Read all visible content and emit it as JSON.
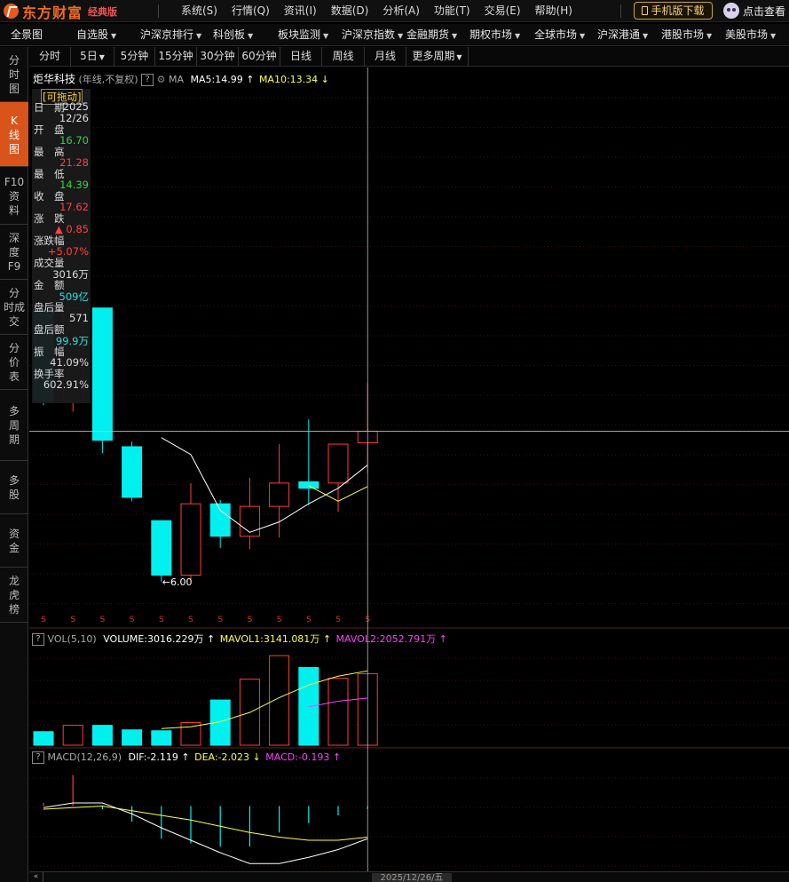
{
  "app": {
    "logo_text": "东方财富",
    "edition": "经典版"
  },
  "menu": [
    "系统(S)",
    "行情(Q)",
    "资讯(I)",
    "数据(D)",
    "分析(A)",
    "功能(T)",
    "交易(E)",
    "帮助(H)"
  ],
  "mobile_download": "手机版下载",
  "view_button": "点击查看",
  "nav": [
    {
      "label": "全景图",
      "dropdown": false
    },
    {
      "label": "自选股",
      "dropdown": true
    },
    {
      "label": "沪深京排行",
      "dropdown": true
    },
    {
      "label": "科创板",
      "dropdown": true
    },
    {
      "label": "板块监测",
      "dropdown": true
    },
    {
      "label": "沪深京指数",
      "dropdown": true
    },
    {
      "label": "金融期货",
      "dropdown": true
    },
    {
      "label": "期权市场",
      "dropdown": true
    },
    {
      "label": "全球市场",
      "dropdown": true
    },
    {
      "label": "沪深港通",
      "dropdown": true
    },
    {
      "label": "港股市场",
      "dropdown": true
    },
    {
      "label": "美股市场",
      "dropdown": true
    }
  ],
  "left_tabs": [
    {
      "label": [
        "分",
        "时",
        "图"
      ],
      "active": false
    },
    {
      "label": [
        "K",
        "线",
        "图"
      ],
      "active": true
    },
    {
      "label": [
        "F10",
        "资",
        "料"
      ],
      "active": false
    },
    {
      "label": [
        "深",
        "度",
        "F9"
      ],
      "active": false
    },
    {
      "label": [
        "分",
        "时成",
        "交"
      ],
      "active": false
    },
    {
      "label": [
        "分",
        "价",
        "表"
      ],
      "active": false
    },
    {
      "label": [
        "多",
        "周",
        "期"
      ],
      "active": false
    },
    {
      "label": [
        "多",
        "股"
      ],
      "active": false
    },
    {
      "label": [
        "资",
        "金"
      ],
      "active": false
    },
    {
      "label": [
        "龙",
        "虎",
        "榜"
      ],
      "active": false
    }
  ],
  "periods": [
    {
      "label": "分时",
      "dropdown": false
    },
    {
      "label": "5日",
      "dropdown": true
    },
    {
      "label": "5分钟",
      "dropdown": false
    },
    {
      "label": "15分钟",
      "dropdown": false
    },
    {
      "label": "30分钟",
      "dropdown": false
    },
    {
      "label": "60分钟",
      "dropdown": false
    },
    {
      "label": "日线",
      "dropdown": false
    },
    {
      "label": "周线",
      "dropdown": false
    },
    {
      "label": "月线",
      "dropdown": false
    },
    {
      "label": "更多周期",
      "dropdown": true
    }
  ],
  "kline_header": {
    "stock_name": "炬华科技",
    "cycle": "(年线,不复权)",
    "q": "?",
    "ma_label": "MA",
    "ma5": "MA5:14.99",
    "ma10": "MA10:13.34",
    "ma5_arrow": "↑",
    "ma10_arrow": "↓"
  },
  "data_window": {
    "drag_label": "[可拖动]",
    "rows": [
      {
        "label": "日　期",
        "value": "2025\n12/26",
        "color": "#dddddd"
      },
      {
        "label": "开　盘",
        "value": "16.70",
        "color": "#32d24a"
      },
      {
        "label": "最　高",
        "value": "21.28",
        "color": "#ff4040"
      },
      {
        "label": "最　低",
        "value": "14.39",
        "color": "#32d24a"
      },
      {
        "label": "收　盘",
        "value": "17.62",
        "color": "#ff4040"
      },
      {
        "label": "涨　跌",
        "value": "▲ 0.85",
        "color": "#ff4040"
      },
      {
        "label": "涨跌幅",
        "value": "+5.07%",
        "color": "#ff4040"
      },
      {
        "label": "成交量",
        "value": "3016万",
        "color": "#dddddd"
      },
      {
        "label": "金　额",
        "value": "509亿",
        "color": "#28e0e0"
      },
      {
        "label": "盘后量",
        "value": "571",
        "color": "#dddddd"
      },
      {
        "label": "盘后额",
        "value": "99.9万",
        "color": "#28e0e0"
      },
      {
        "label": "振　幅",
        "value": "41.09%",
        "color": "#dddddd"
      },
      {
        "label": "换手率",
        "value": "602.91%",
        "color": "#dddddd"
      }
    ]
  },
  "vol_header": {
    "q": "?",
    "label": "VOL(5,10)",
    "volume": "VOLUME:3016.229万",
    "mavol1": "MAVOL1:3141.081万",
    "mavol2": "MAVOL2:2052.791万",
    "arrow": "↑"
  },
  "macd_header": {
    "q": "?",
    "label": "MACD(12,26,9)",
    "dif": "DIF:-2.119",
    "dea": "DEA:-2.023",
    "macd": "MACD:-0.193",
    "dif_arrow": "↑",
    "dea_arrow": "↓",
    "macd_arrow": "↑"
  },
  "low_marker": "←6.00",
  "bottom_date": "2025/12/26/五",
  "colors": {
    "up": "#ff3c3c",
    "down": "#00f0f0",
    "ma5": "#ffffff",
    "ma10": "#ffff40",
    "mavol2": "#ff40ff",
    "accent": "#d9541a"
  },
  "chart_data": {
    "type": "candlestick",
    "candles": [
      {
        "open": 27.1,
        "close": 19.9,
        "high": 27.1,
        "low": 19.6,
        "dir": "down"
      },
      {
        "open": 19.9,
        "close": 27.1,
        "high": 27.1,
        "low": 19.1,
        "dir": "up"
      },
      {
        "open": 27.1,
        "close": 16.9,
        "high": 27.1,
        "low": 15.9,
        "dir": "down"
      },
      {
        "open": 16.4,
        "close": 12.5,
        "high": 16.8,
        "low": 12.2,
        "dir": "down"
      },
      {
        "open": 10.7,
        "close": 6.5,
        "high": 10.7,
        "low": 6.0,
        "dir": "down"
      },
      {
        "open": 6.5,
        "close": 12.0,
        "high": 13.6,
        "low": 6.1,
        "dir": "up"
      },
      {
        "open": 12.0,
        "close": 9.5,
        "high": 12.3,
        "low": 8.6,
        "dir": "down"
      },
      {
        "open": 9.5,
        "close": 11.8,
        "high": 14.0,
        "low": 8.5,
        "dir": "up"
      },
      {
        "open": 11.8,
        "close": 13.6,
        "high": 16.6,
        "low": 9.4,
        "dir": "up"
      },
      {
        "open": 13.7,
        "close": 13.2,
        "high": 18.5,
        "low": 11.9,
        "dir": "down"
      },
      {
        "open": 13.6,
        "close": 16.6,
        "high": 16.6,
        "low": 11.4,
        "dir": "up"
      },
      {
        "open": 16.7,
        "close": 17.6,
        "high": 21.3,
        "low": 14.4,
        "dir": "up"
      }
    ],
    "ma5": [
      null,
      null,
      null,
      null,
      17.1,
      15.8,
      11.5,
      9.8,
      10.6,
      12.0,
      13.2,
      14.99
    ],
    "ma10": [
      null,
      null,
      null,
      null,
      null,
      null,
      null,
      null,
      null,
      13.4,
      12.2,
      13.34
    ],
    "volume": [
      15,
      22,
      22,
      17,
      16,
      25,
      50,
      73,
      99,
      86,
      74,
      79
    ],
    "mavol1": [
      null,
      null,
      null,
      null,
      18.4,
      20.4,
      26,
      36.2,
      52.6,
      66.6,
      76.4,
      82.2
    ],
    "mavol2": [
      null,
      null,
      null,
      null,
      null,
      null,
      null,
      null,
      null,
      42.5,
      48.6,
      52.2
    ],
    "macd_bar": [
      0.2,
      2.0,
      -0.2,
      -1.0,
      -2.1,
      -2.4,
      -2.6,
      -2.6,
      -1.7,
      -1.1,
      -0.6,
      -0.2
    ],
    "dif": [
      -0.1,
      0.2,
      0.2,
      -0.5,
      -1.4,
      -2.2,
      -3.0,
      -3.7,
      -3.7,
      -3.3,
      -2.8,
      -2.1
    ],
    "dea": [
      -0.2,
      -0.1,
      0.0,
      -0.3,
      -0.6,
      -0.9,
      -1.3,
      -1.7,
      -2.0,
      -2.2,
      -2.2,
      -2.0
    ],
    "price_ylim": [
      4,
      44
    ],
    "vol_ylim": [
      0,
      110
    ],
    "macd_ylim": [
      -4.2,
      2.6
    ]
  }
}
